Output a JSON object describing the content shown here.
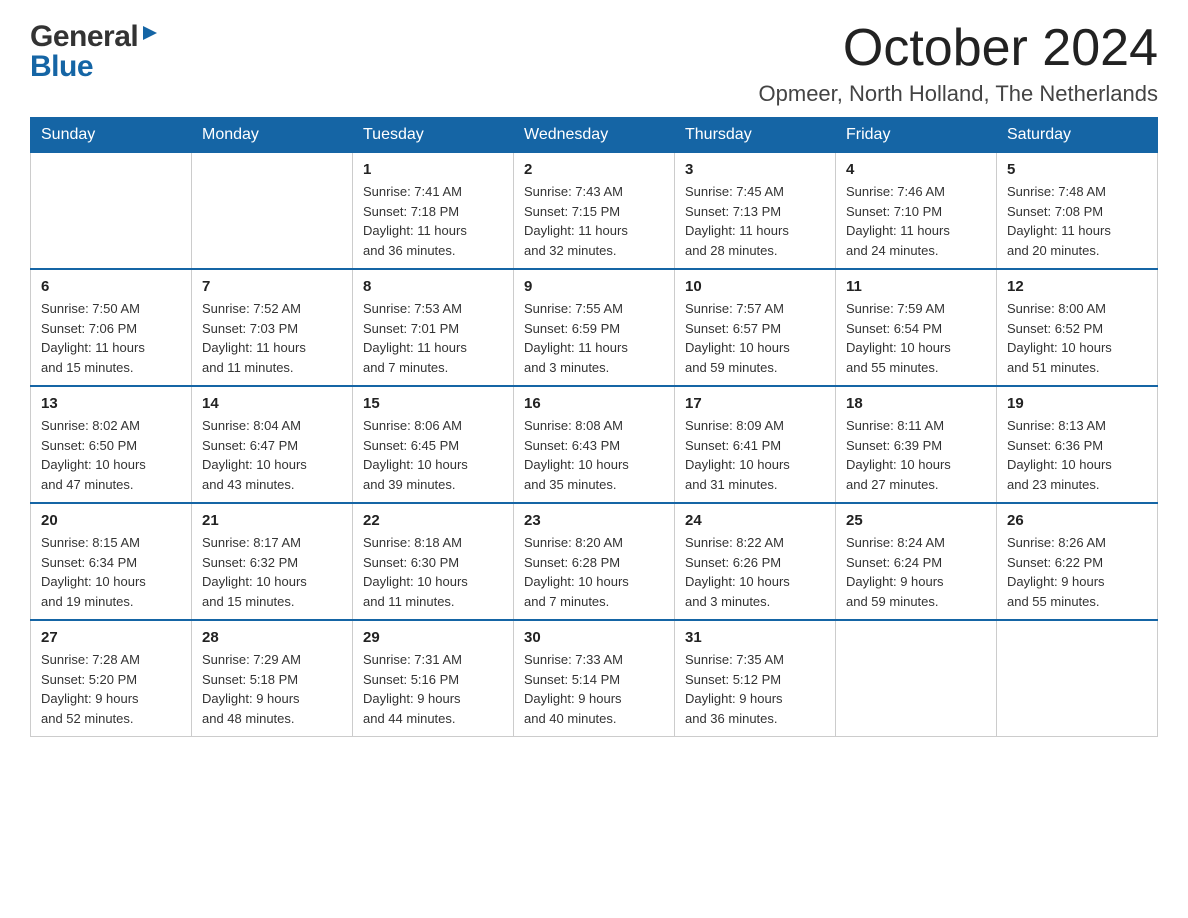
{
  "logo": {
    "general": "General",
    "blue": "Blue"
  },
  "title": "October 2024",
  "location": "Opmeer, North Holland, The Netherlands",
  "days_of_week": [
    "Sunday",
    "Monday",
    "Tuesday",
    "Wednesday",
    "Thursday",
    "Friday",
    "Saturday"
  ],
  "weeks": [
    [
      {
        "day": "",
        "info": ""
      },
      {
        "day": "",
        "info": ""
      },
      {
        "day": "1",
        "info": "Sunrise: 7:41 AM\nSunset: 7:18 PM\nDaylight: 11 hours\nand 36 minutes."
      },
      {
        "day": "2",
        "info": "Sunrise: 7:43 AM\nSunset: 7:15 PM\nDaylight: 11 hours\nand 32 minutes."
      },
      {
        "day": "3",
        "info": "Sunrise: 7:45 AM\nSunset: 7:13 PM\nDaylight: 11 hours\nand 28 minutes."
      },
      {
        "day": "4",
        "info": "Sunrise: 7:46 AM\nSunset: 7:10 PM\nDaylight: 11 hours\nand 24 minutes."
      },
      {
        "day": "5",
        "info": "Sunrise: 7:48 AM\nSunset: 7:08 PM\nDaylight: 11 hours\nand 20 minutes."
      }
    ],
    [
      {
        "day": "6",
        "info": "Sunrise: 7:50 AM\nSunset: 7:06 PM\nDaylight: 11 hours\nand 15 minutes."
      },
      {
        "day": "7",
        "info": "Sunrise: 7:52 AM\nSunset: 7:03 PM\nDaylight: 11 hours\nand 11 minutes."
      },
      {
        "day": "8",
        "info": "Sunrise: 7:53 AM\nSunset: 7:01 PM\nDaylight: 11 hours\nand 7 minutes."
      },
      {
        "day": "9",
        "info": "Sunrise: 7:55 AM\nSunset: 6:59 PM\nDaylight: 11 hours\nand 3 minutes."
      },
      {
        "day": "10",
        "info": "Sunrise: 7:57 AM\nSunset: 6:57 PM\nDaylight: 10 hours\nand 59 minutes."
      },
      {
        "day": "11",
        "info": "Sunrise: 7:59 AM\nSunset: 6:54 PM\nDaylight: 10 hours\nand 55 minutes."
      },
      {
        "day": "12",
        "info": "Sunrise: 8:00 AM\nSunset: 6:52 PM\nDaylight: 10 hours\nand 51 minutes."
      }
    ],
    [
      {
        "day": "13",
        "info": "Sunrise: 8:02 AM\nSunset: 6:50 PM\nDaylight: 10 hours\nand 47 minutes."
      },
      {
        "day": "14",
        "info": "Sunrise: 8:04 AM\nSunset: 6:47 PM\nDaylight: 10 hours\nand 43 minutes."
      },
      {
        "day": "15",
        "info": "Sunrise: 8:06 AM\nSunset: 6:45 PM\nDaylight: 10 hours\nand 39 minutes."
      },
      {
        "day": "16",
        "info": "Sunrise: 8:08 AM\nSunset: 6:43 PM\nDaylight: 10 hours\nand 35 minutes."
      },
      {
        "day": "17",
        "info": "Sunrise: 8:09 AM\nSunset: 6:41 PM\nDaylight: 10 hours\nand 31 minutes."
      },
      {
        "day": "18",
        "info": "Sunrise: 8:11 AM\nSunset: 6:39 PM\nDaylight: 10 hours\nand 27 minutes."
      },
      {
        "day": "19",
        "info": "Sunrise: 8:13 AM\nSunset: 6:36 PM\nDaylight: 10 hours\nand 23 minutes."
      }
    ],
    [
      {
        "day": "20",
        "info": "Sunrise: 8:15 AM\nSunset: 6:34 PM\nDaylight: 10 hours\nand 19 minutes."
      },
      {
        "day": "21",
        "info": "Sunrise: 8:17 AM\nSunset: 6:32 PM\nDaylight: 10 hours\nand 15 minutes."
      },
      {
        "day": "22",
        "info": "Sunrise: 8:18 AM\nSunset: 6:30 PM\nDaylight: 10 hours\nand 11 minutes."
      },
      {
        "day": "23",
        "info": "Sunrise: 8:20 AM\nSunset: 6:28 PM\nDaylight: 10 hours\nand 7 minutes."
      },
      {
        "day": "24",
        "info": "Sunrise: 8:22 AM\nSunset: 6:26 PM\nDaylight: 10 hours\nand 3 minutes."
      },
      {
        "day": "25",
        "info": "Sunrise: 8:24 AM\nSunset: 6:24 PM\nDaylight: 9 hours\nand 59 minutes."
      },
      {
        "day": "26",
        "info": "Sunrise: 8:26 AM\nSunset: 6:22 PM\nDaylight: 9 hours\nand 55 minutes."
      }
    ],
    [
      {
        "day": "27",
        "info": "Sunrise: 7:28 AM\nSunset: 5:20 PM\nDaylight: 9 hours\nand 52 minutes."
      },
      {
        "day": "28",
        "info": "Sunrise: 7:29 AM\nSunset: 5:18 PM\nDaylight: 9 hours\nand 48 minutes."
      },
      {
        "day": "29",
        "info": "Sunrise: 7:31 AM\nSunset: 5:16 PM\nDaylight: 9 hours\nand 44 minutes."
      },
      {
        "day": "30",
        "info": "Sunrise: 7:33 AM\nSunset: 5:14 PM\nDaylight: 9 hours\nand 40 minutes."
      },
      {
        "day": "31",
        "info": "Sunrise: 7:35 AM\nSunset: 5:12 PM\nDaylight: 9 hours\nand 36 minutes."
      },
      {
        "day": "",
        "info": ""
      },
      {
        "day": "",
        "info": ""
      }
    ]
  ]
}
